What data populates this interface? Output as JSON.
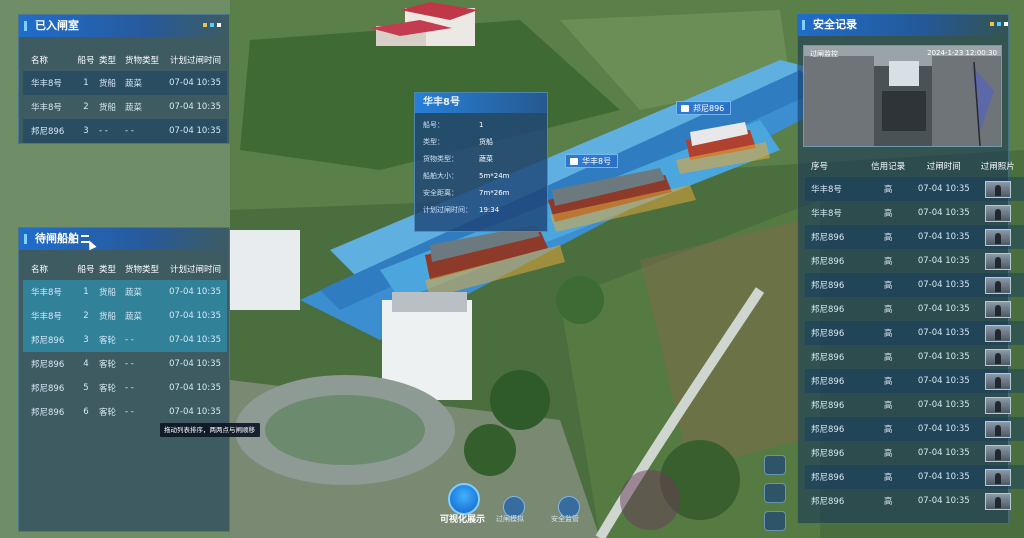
{
  "left_top_panel": {
    "title": "已入闸室",
    "headers": [
      "名称",
      "船号",
      "类型",
      "货物类型",
      "计划过闸时间"
    ],
    "rows": [
      [
        "华丰8号",
        "1",
        "货船",
        "蔬菜",
        "07-04 10:35"
      ],
      [
        "华丰8号",
        "2",
        "货船",
        "蔬菜",
        "07-04 10:35"
      ],
      [
        "邦尼896",
        "3",
        "- -",
        "- -",
        "07-04 10:35"
      ]
    ]
  },
  "left_bottom_panel": {
    "title": "待闸船舶",
    "headers": [
      "名称",
      "船号",
      "类型",
      "货物类型",
      "计划过闸时间"
    ],
    "rows": [
      [
        "华丰8号",
        "1",
        "货船",
        "蔬菜",
        "07-04 10:35"
      ],
      [
        "华丰8号",
        "2",
        "货船",
        "蔬菜",
        "07-04 10:35"
      ],
      [
        "邦尼896",
        "3",
        "客轮",
        "- -",
        "07-04 10:35"
      ],
      [
        "邦尼896",
        "4",
        "客轮",
        "- -",
        "07-04 10:35"
      ],
      [
        "邦尼896",
        "5",
        "客轮",
        "- -",
        "07-04 10:35"
      ],
      [
        "邦尼896",
        "6",
        "客轮",
        "- -",
        "07-04 10:35"
      ]
    ],
    "tooltip": "拖动列表排序，两两点与闸顺移"
  },
  "info_card": {
    "title": "华丰8号",
    "fields": [
      {
        "k": "船号：",
        "v": "1"
      },
      {
        "k": "类型：",
        "v": "货船"
      },
      {
        "k": "货物类型：",
        "v": "蔬菜"
      },
      {
        "k": "船舶大小：",
        "v": "5m*24m"
      },
      {
        "k": "安全距离：",
        "v": "7m*26m"
      },
      {
        "k": "计划过闸时间：",
        "v": "19:34"
      }
    ]
  },
  "ship_labels": {
    "front": "邦尼896",
    "middle": "华丰8号"
  },
  "safety_panel": {
    "title": "安全记录",
    "photo_caption": "过闸监控",
    "photo_time": "2024-1-23 12:00:30",
    "headers": [
      "序号",
      "信用记录",
      "过闸时间",
      "过闸照片"
    ],
    "rows": [
      [
        "华丰8号",
        "高",
        "07-04 10:35"
      ],
      [
        "华丰8号",
        "高",
        "07-04 10:35"
      ],
      [
        "邦尼896",
        "高",
        "07-04 10:35"
      ],
      [
        "邦尼896",
        "高",
        "07-04 10:35"
      ],
      [
        "邦尼896",
        "高",
        "07-04 10:35"
      ],
      [
        "邦尼896",
        "高",
        "07-04 10:35"
      ],
      [
        "邦尼896",
        "高",
        "07-04 10:35"
      ],
      [
        "邦尼896",
        "高",
        "07-04 10:35"
      ],
      [
        "邦尼896",
        "高",
        "07-04 10:35"
      ],
      [
        "邦尼896",
        "高",
        "07-04 10:35"
      ],
      [
        "邦尼896",
        "高",
        "07-04 10:35"
      ],
      [
        "邦尼896",
        "高",
        "07-04 10:35"
      ],
      [
        "邦尼896",
        "高",
        "07-04 10:35"
      ],
      [
        "邦尼896",
        "高",
        "07-04 10:35"
      ]
    ]
  },
  "bottom_nav": {
    "main": "可视化展示",
    "items": [
      "过闸模拟",
      "安全监管"
    ]
  },
  "colors": {
    "accent": "#1e6ed2",
    "highlight": "#28a0c8",
    "dot1": "#f6c140",
    "dot2": "#4fd0ff",
    "dot3": "#ffffff"
  },
  "icons": [
    "list-icon",
    "ship-icon",
    "visualization-icon",
    "simulation-icon",
    "safety-icon",
    "clipboard-icon",
    "camera-icon",
    "globe-icon"
  ]
}
